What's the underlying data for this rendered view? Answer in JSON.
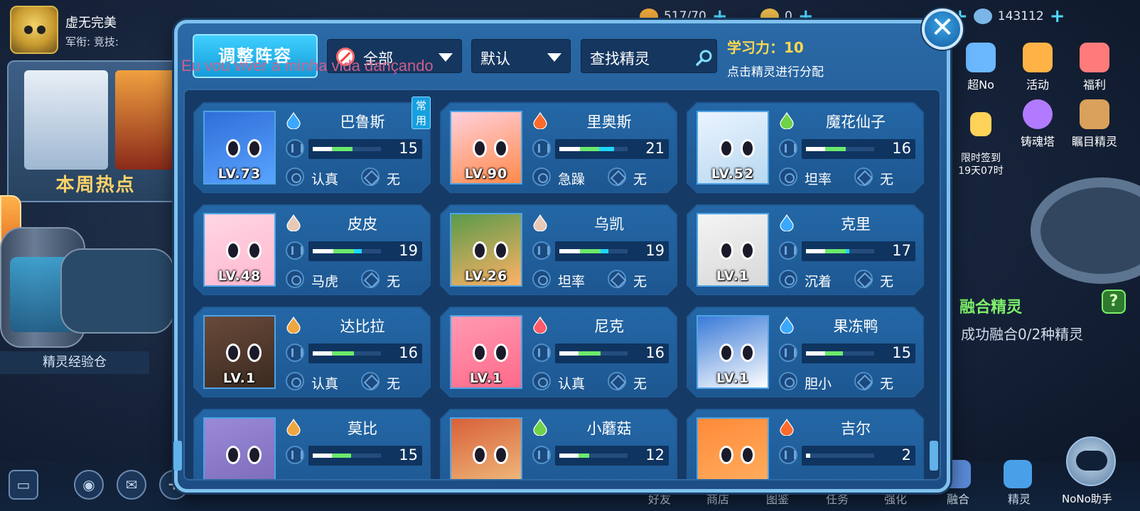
{
  "player": {
    "name": "虚无完美",
    "tags": "军衔: 竞技:"
  },
  "resources": [
    {
      "value": "517/70",
      "color": "#f0a83a"
    },
    {
      "value": "0",
      "color": "#e8b94a"
    },
    {
      "value": "143112",
      "color": "#7bb6e8"
    }
  ],
  "plus_symbol": "+",
  "left_panel": {
    "hot_label": "本周热点",
    "exp_label": "精灵经验仓"
  },
  "right_icons": [
    {
      "label": "超No",
      "color": "#6bb8ff"
    },
    {
      "label": "活动",
      "color": "#ffb347"
    },
    {
      "label": "福利",
      "color": "#ff7b7b"
    },
    {
      "label": "限时签到\n19天07时",
      "color": "#ffd35a"
    },
    {
      "label": "铸魂塔",
      "color": "#b27bff"
    },
    {
      "label": "瞩目精灵",
      "color": "#d9a15b"
    }
  ],
  "fusion": {
    "title": "融合精灵",
    "desc": "成功融合0/2种精灵",
    "help": "?"
  },
  "bottom_nav": [
    "好友",
    "商店",
    "图鉴",
    "任务",
    "强化",
    "融合",
    "精灵"
  ],
  "nono_label": "NoNo助手",
  "modal": {
    "adjust_button": "调整阵容",
    "filter_all": "全部",
    "sort_default": "默认",
    "search_placeholder": "查找精灵",
    "learn_power": "学习力：10",
    "learn_tip": "点击精灵进行分配",
    "close": "✕",
    "overlay_lyric": "Eu vou viver a minha vida dançando"
  },
  "colors": {
    "water": "#3aa8ff",
    "fire": "#ff6a2a",
    "grass": "#6fd24a",
    "flying": "#e8c9b8",
    "ground": "#f0a640",
    "normal": "#ff5a6a"
  },
  "pets": [
    {
      "name": "巴鲁斯",
      "level": "LV.73",
      "element": "water",
      "stat": "15",
      "w": 28,
      "g": 30,
      "c": 0,
      "nature": "认真",
      "ability": "无",
      "badge": "常用",
      "bg": "#2f6ed8",
      "fg": "#5aa4ff"
    },
    {
      "name": "里奥斯",
      "level": "LV.90",
      "element": "fire",
      "stat": "21",
      "w": 30,
      "g": 28,
      "c": 22,
      "nature": "急躁",
      "ability": "无",
      "badge": "",
      "bg": "#ffd0dc",
      "fg": "#ff8a4a"
    },
    {
      "name": "魔花仙子",
      "level": "LV.52",
      "element": "grass",
      "stat": "16",
      "w": 28,
      "g": 30,
      "c": 0,
      "nature": "坦率",
      "ability": "无",
      "badge": "",
      "bg": "#eaf4ff",
      "fg": "#b8d8f0"
    },
    {
      "name": "皮皮",
      "level": "LV.48",
      "element": "flying",
      "stat": "19",
      "w": 30,
      "g": 30,
      "c": 12,
      "nature": "马虎",
      "ability": "无",
      "badge": "",
      "bg": "#ffd6e4",
      "fg": "#ffb8cf"
    },
    {
      "name": "乌凯",
      "level": "LV.26",
      "element": "flying",
      "stat": "19",
      "w": 30,
      "g": 30,
      "c": 12,
      "nature": "坦率",
      "ability": "无",
      "badge": "",
      "bg": "#5a9a4a",
      "fg": "#ffb266"
    },
    {
      "name": "克里",
      "level": "LV.1",
      "element": "water",
      "stat": "17",
      "w": 28,
      "g": 30,
      "c": 6,
      "nature": "沉着",
      "ability": "无",
      "badge": "",
      "bg": "#f4f4f4",
      "fg": "#d8d8d8"
    },
    {
      "name": "达比拉",
      "level": "LV.1",
      "element": "ground",
      "stat": "16",
      "w": 28,
      "g": 32,
      "c": 0,
      "nature": "认真",
      "ability": "无",
      "badge": "",
      "bg": "#6a4a3a",
      "fg": "#3a2a20"
    },
    {
      "name": "尼克",
      "level": "LV.1",
      "element": "normal",
      "stat": "16",
      "w": 28,
      "g": 32,
      "c": 0,
      "nature": "认真",
      "ability": "无",
      "badge": "",
      "bg": "#ff9ab2",
      "fg": "#ff6a8a"
    },
    {
      "name": "果冻鸭",
      "level": "LV.1",
      "element": "water",
      "stat": "15",
      "w": 28,
      "g": 26,
      "c": 0,
      "nature": "胆小",
      "ability": "无",
      "badge": "",
      "bg": "#3a7ad8",
      "fg": "#ffffff"
    },
    {
      "name": "莫比",
      "level": "",
      "element": "ground",
      "stat": "15",
      "w": 28,
      "g": 28,
      "c": 0,
      "nature": "",
      "ability": "",
      "badge": "",
      "bg": "#9a8ad8",
      "fg": "#7a6ab8"
    },
    {
      "name": "小蘑菇",
      "level": "",
      "element": "grass",
      "stat": "12",
      "w": 28,
      "g": 16,
      "c": 0,
      "nature": "",
      "ability": "",
      "badge": "",
      "bg": "#d8603a",
      "fg": "#f0c080"
    },
    {
      "name": "吉尔",
      "level": "",
      "element": "fire",
      "stat": "2",
      "w": 6,
      "g": 0,
      "c": 0,
      "nature": "",
      "ability": "",
      "badge": "",
      "bg": "#ff8a3a",
      "fg": "#ffb060"
    }
  ]
}
